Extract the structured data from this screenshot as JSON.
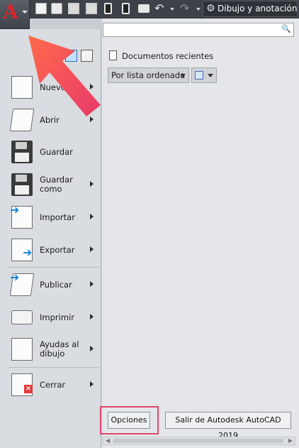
{
  "toolbar": {
    "workspace_label": "Dibujo y anotación"
  },
  "menu": {
    "items": [
      {
        "label": "Nuevo",
        "has_arrow": true
      },
      {
        "label": "Abrir",
        "has_arrow": true
      },
      {
        "label": "Guardar",
        "has_arrow": false
      },
      {
        "label": "Guardar\ncomo",
        "has_arrow": true
      },
      {
        "label": "Importar",
        "has_arrow": true
      },
      {
        "label": "Exportar",
        "has_arrow": true
      },
      {
        "label": "Publicar",
        "has_arrow": true
      },
      {
        "label": "Imprimir",
        "has_arrow": true
      },
      {
        "label": "Ayudas al\ndibujo",
        "has_arrow": true
      },
      {
        "label": "Cerrar",
        "has_arrow": true
      }
    ]
  },
  "panel": {
    "search_placeholder": "",
    "recent_title": "Documentos recientes",
    "sort_label": "Por lista ordenada",
    "options_button": "Opciones",
    "exit_button": "Salir de Autodesk AutoCAD 2019"
  },
  "colors": {
    "highlight_box": "#e0466a",
    "annotation_arrow": "#f0506a",
    "logo_red": "#d8262c",
    "accent_blue": "#1f86d6"
  }
}
